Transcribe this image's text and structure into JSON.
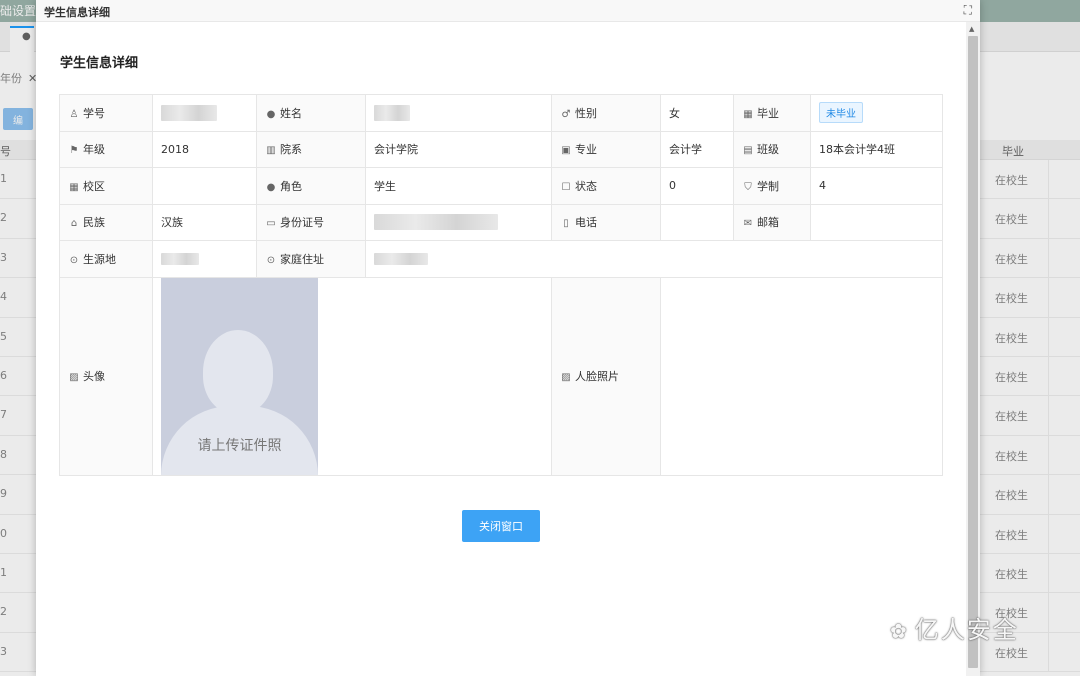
{
  "background": {
    "app_title": "础设置",
    "filter_label": "年份",
    "filter_close": "✕",
    "edit_button_label": "编",
    "grid_header_no": "号",
    "grid_header_status": "毕业",
    "rows": [
      {
        "no": "1",
        "status": "在校生"
      },
      {
        "no": "2",
        "status": "在校生"
      },
      {
        "no": "3",
        "status": "在校生"
      },
      {
        "no": "4",
        "status": "在校生"
      },
      {
        "no": "5",
        "status": "在校生"
      },
      {
        "no": "6",
        "status": "在校生"
      },
      {
        "no": "7",
        "status": "在校生"
      },
      {
        "no": "8",
        "status": "在校生"
      },
      {
        "no": "9",
        "status": "在校生"
      },
      {
        "no": "0",
        "status": "在校生"
      },
      {
        "no": "1",
        "status": "在校生"
      },
      {
        "no": "2",
        "status": "在校生"
      },
      {
        "no": "3",
        "status": "在校生"
      }
    ]
  },
  "dialog": {
    "title": "学生信息详细",
    "close_icon": "⛶",
    "section_title": "学生信息详细",
    "close_button_label": "关闭窗口"
  },
  "info": {
    "student_id_label": "学号",
    "name_label": "姓名",
    "gender_label": "性别",
    "gender_value": "女",
    "graduation_label": "毕业",
    "graduation_value": "未毕业",
    "grade_label": "年级",
    "grade_value": "2018",
    "college_label": "院系",
    "college_value": "会计学院",
    "major_label": "专业",
    "major_value": "会计学",
    "class_label": "班级",
    "class_value": "18本会计学4班",
    "campus_label": "校区",
    "campus_value": "",
    "role_label": "角色",
    "role_value": "学生",
    "state_label": "状态",
    "state_value": "0",
    "duration_label": "学制",
    "duration_value": "4",
    "ethnicity_label": "民族",
    "ethnicity_value": "汉族",
    "id_card_label": "身份证号",
    "phone_label": "电话",
    "phone_value": "",
    "email_label": "邮箱",
    "email_value": "",
    "origin_label": "生源地",
    "address_label": "家庭住址",
    "avatar_label": "头像",
    "avatar_placeholder": "请上传证件照",
    "face_photo_label": "人脸照片"
  },
  "watermark": {
    "text": "亿人安全"
  }
}
